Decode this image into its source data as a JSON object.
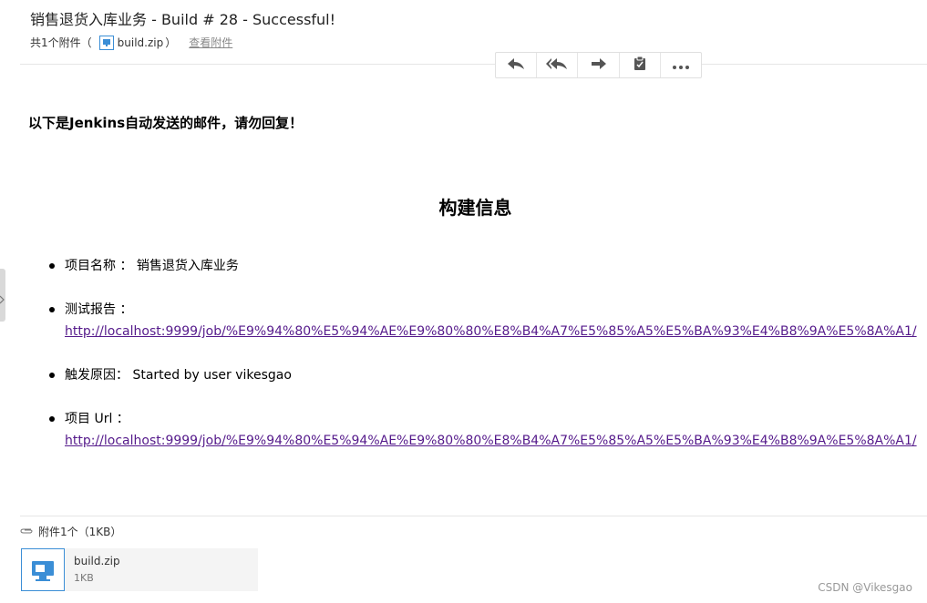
{
  "email": {
    "subject": "销售退货入库业务 - Build # 28 - Successful!",
    "attachment_prefix": "共1个附件（",
    "attachment_file": "build.zip",
    "attachment_suffix": "）",
    "view_attachments": "查看附件"
  },
  "toolbar": {
    "items": [
      {
        "icon": "reply-icon"
      },
      {
        "icon": "reply-all-icon"
      },
      {
        "icon": "forward-icon"
      },
      {
        "icon": "clipboard-icon"
      },
      {
        "icon": "more-icon"
      }
    ]
  },
  "body": {
    "greeting": "以下是Jenkins自动发送的邮件，请勿回复！",
    "build_title": "构建信息",
    "project_name_label": "项目名称 ：",
    "project_name_value": "销售退货入库业务",
    "test_report_label": "测试报告 ：",
    "test_report_url": "http://localhost:9999/job/%E9%94%80%E5%94%AE%E9%80%80%E8%B4%A7%E5%85%A5%E5%BA%93%E4%B8%9A%E5%8A%A1/",
    "trigger_label": "触发原因：",
    "trigger_value": "Started by user vikesgao",
    "project_url_label": "项目 Url ：",
    "project_url": "http://localhost:9999/job/%E9%94%80%E5%94%AE%E9%80%80%E8%B4%A7%E5%85%A5%E5%BA%93%E4%B8%9A%E5%8A%A1/"
  },
  "attachments": {
    "summary": "附件1个（1KB）",
    "file_name": "build.zip",
    "file_size": "1KB"
  },
  "watermark": "CSDN @Vikesgao"
}
